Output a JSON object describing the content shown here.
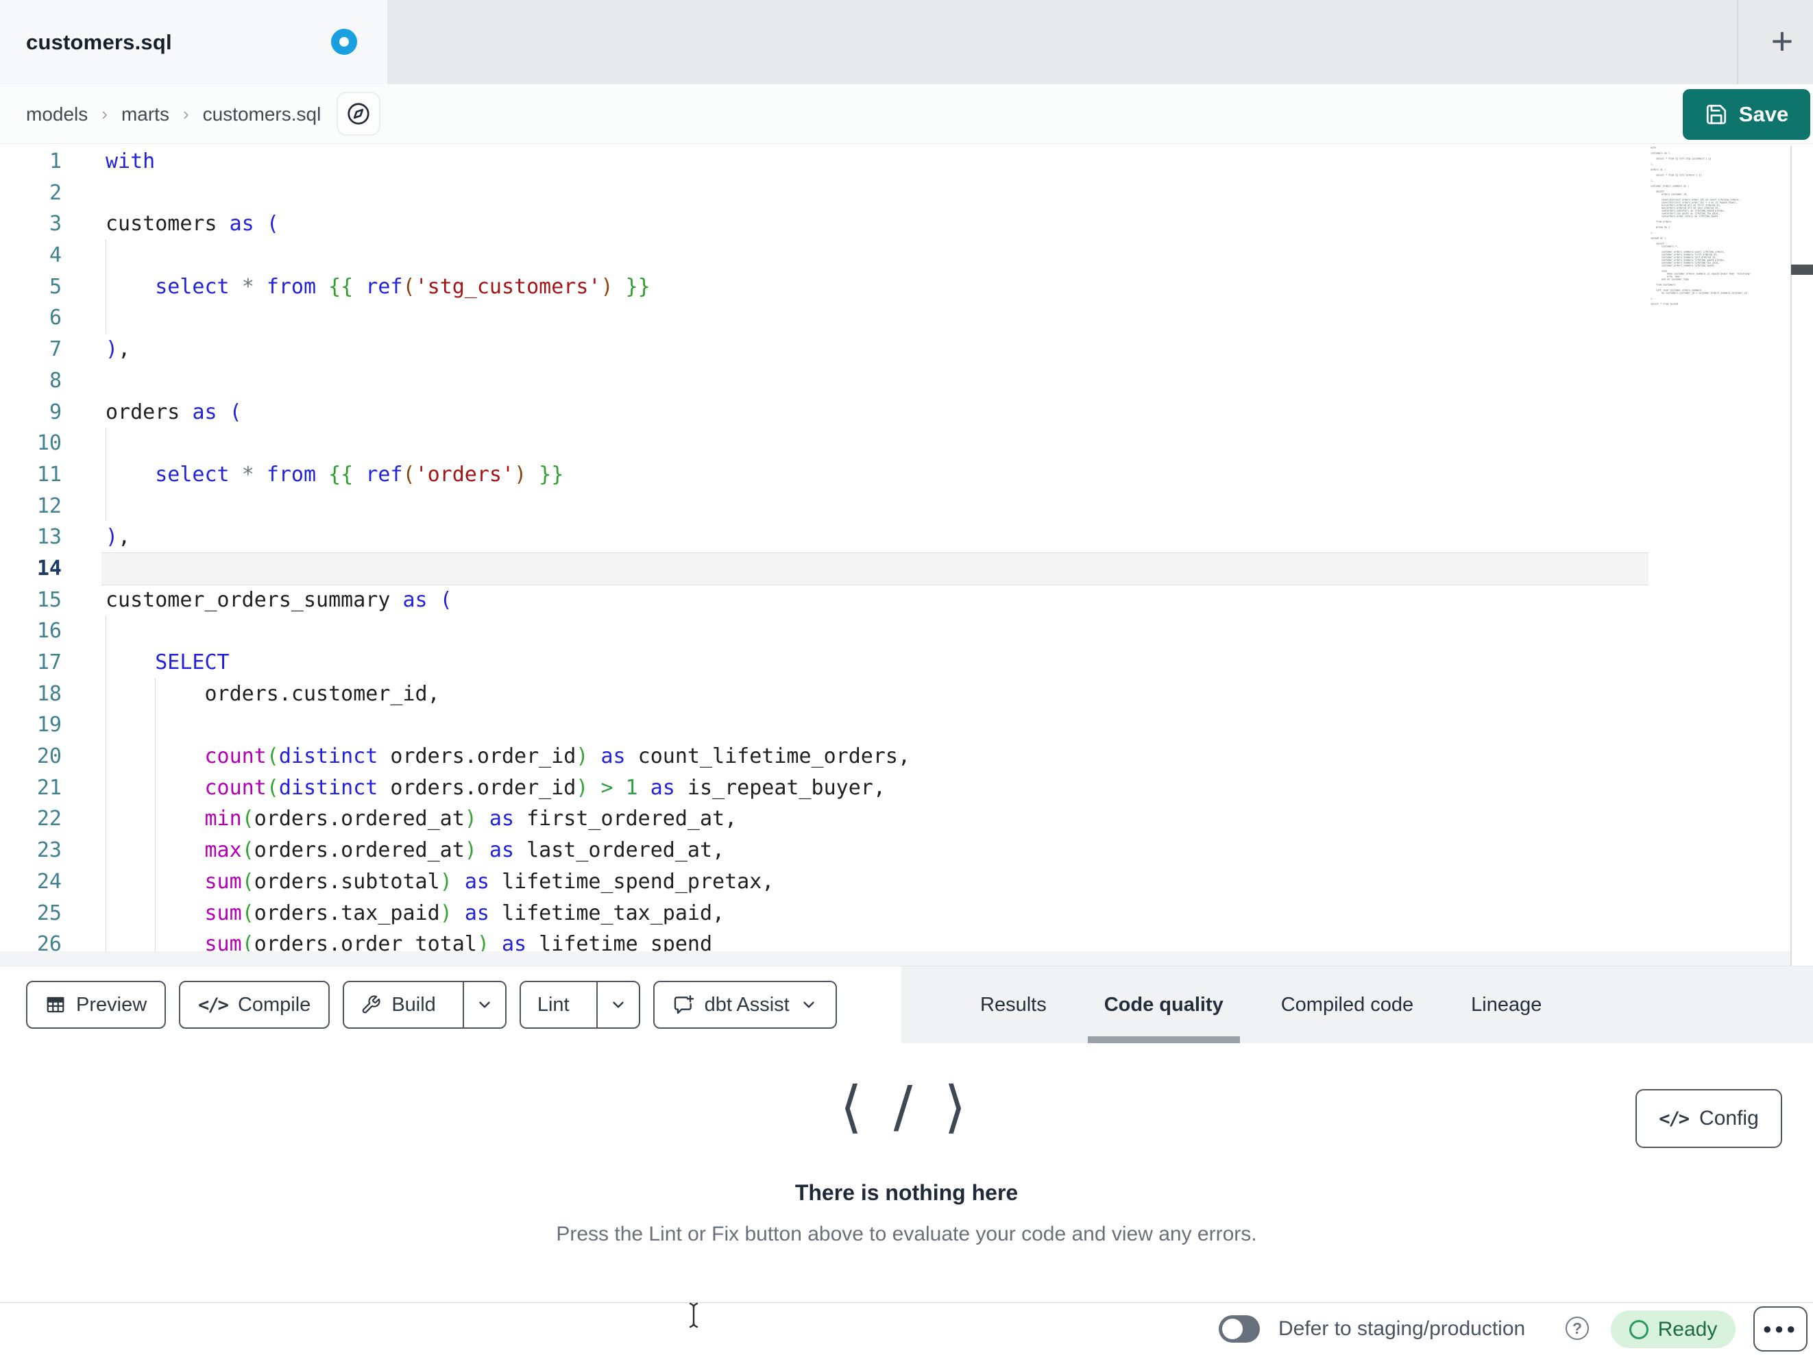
{
  "theme": {
    "tab-bg": "#e8e9ea",
    "surface": "#f7f8f9",
    "save": "#0e756d",
    "dot": "#18a0e0",
    "tok-k": "#2222dd",
    "tok-f": "#b400b4",
    "tok-p": "#36a336",
    "tok-j": "#2e9e2e",
    "tok-jb": "#8b4513",
    "tok-s": "#a31515",
    "tok-n": "#2f9e44",
    "tok-o": "#6e7680",
    "tok-d": "#1f1f1f",
    "ln": "#40808f",
    "ln-active": "#1d3a66",
    "guide": "#d9dadc",
    "active-line-bg": "#f4f4f5",
    "active-line-border": "#dcdee0",
    "btn-border": "#4d5660",
    "tabs-strip": "#f1f2f3",
    "underline": "#9aa0a8",
    "ready-bg": "#d8f2de",
    "ready-fg": "#1d6b3f",
    "ready-ring": "#2a9960",
    "toggle": "#67707c"
  },
  "tab_bar": {
    "active_tab": "customers.sql",
    "new_tab_label": "+"
  },
  "breadcrumb": {
    "items": [
      "models",
      "marts",
      "customers.sql"
    ],
    "separator": "›"
  },
  "save_button": {
    "label": "Save"
  },
  "editor": {
    "active_line": 14,
    "lines": [
      {
        "n": 1,
        "t": [
          [
            "k",
            "with"
          ]
        ]
      },
      {
        "n": 2,
        "t": []
      },
      {
        "n": 3,
        "t": [
          [
            "d",
            "customers "
          ],
          [
            "k",
            "as"
          ],
          [
            "d",
            " "
          ],
          [
            "k",
            "("
          ]
        ]
      },
      {
        "n": 4,
        "g": [
          0
        ],
        "t": []
      },
      {
        "n": 5,
        "g": [
          0
        ],
        "t": [
          [
            "d",
            "    "
          ],
          [
            "k",
            "select"
          ],
          [
            "d",
            " "
          ],
          [
            "o",
            "*"
          ],
          [
            "d",
            " "
          ],
          [
            "k",
            "from"
          ],
          [
            "d",
            " "
          ],
          [
            "j",
            "{{ "
          ],
          [
            "k",
            "ref"
          ],
          [
            "jb",
            "("
          ],
          [
            "s",
            "'stg_customers'"
          ],
          [
            "jb",
            ")"
          ],
          [
            "j",
            " }}"
          ]
        ]
      },
      {
        "n": 6,
        "g": [
          0
        ],
        "t": []
      },
      {
        "n": 7,
        "t": [
          [
            "k",
            ")"
          ],
          [
            "d",
            ","
          ]
        ]
      },
      {
        "n": 8,
        "t": []
      },
      {
        "n": 9,
        "t": [
          [
            "d",
            "orders "
          ],
          [
            "k",
            "as"
          ],
          [
            "d",
            " "
          ],
          [
            "k",
            "("
          ]
        ]
      },
      {
        "n": 10,
        "g": [
          0
        ],
        "t": []
      },
      {
        "n": 11,
        "g": [
          0
        ],
        "t": [
          [
            "d",
            "    "
          ],
          [
            "k",
            "select"
          ],
          [
            "d",
            " "
          ],
          [
            "o",
            "*"
          ],
          [
            "d",
            " "
          ],
          [
            "k",
            "from"
          ],
          [
            "d",
            " "
          ],
          [
            "j",
            "{{ "
          ],
          [
            "k",
            "ref"
          ],
          [
            "jb",
            "("
          ],
          [
            "s",
            "'orders'"
          ],
          [
            "jb",
            ")"
          ],
          [
            "j",
            " }}"
          ]
        ]
      },
      {
        "n": 12,
        "g": [
          0
        ],
        "t": []
      },
      {
        "n": 13,
        "t": [
          [
            "k",
            ")"
          ],
          [
            "d",
            ","
          ]
        ]
      },
      {
        "n": 14,
        "t": []
      },
      {
        "n": 15,
        "t": [
          [
            "d",
            "customer_orders_summary "
          ],
          [
            "k",
            "as"
          ],
          [
            "d",
            " "
          ],
          [
            "k",
            "("
          ]
        ]
      },
      {
        "n": 16,
        "g": [
          0
        ],
        "t": []
      },
      {
        "n": 17,
        "g": [
          0
        ],
        "t": [
          [
            "d",
            "    "
          ],
          [
            "k",
            "SELECT"
          ]
        ]
      },
      {
        "n": 18,
        "g": [
          0,
          4
        ],
        "t": [
          [
            "d",
            "        orders.customer_id,"
          ]
        ]
      },
      {
        "n": 19,
        "g": [
          0,
          4
        ],
        "t": []
      },
      {
        "n": 20,
        "g": [
          0,
          4
        ],
        "t": [
          [
            "d",
            "        "
          ],
          [
            "f",
            "count"
          ],
          [
            "p",
            "("
          ],
          [
            "k",
            "distinct"
          ],
          [
            "d",
            " orders.order_id"
          ],
          [
            "p",
            ")"
          ],
          [
            "d",
            " "
          ],
          [
            "k",
            "as"
          ],
          [
            "d",
            " count_lifetime_orders,"
          ]
        ]
      },
      {
        "n": 21,
        "g": [
          0,
          4
        ],
        "t": [
          [
            "d",
            "        "
          ],
          [
            "f",
            "count"
          ],
          [
            "p",
            "("
          ],
          [
            "k",
            "distinct"
          ],
          [
            "d",
            " orders.order_id"
          ],
          [
            "p",
            ")"
          ],
          [
            "d",
            " "
          ],
          [
            "n",
            ">"
          ],
          [
            "d",
            " "
          ],
          [
            "n",
            "1"
          ],
          [
            "d",
            " "
          ],
          [
            "k",
            "as"
          ],
          [
            "d",
            " is_repeat_buyer,"
          ]
        ]
      },
      {
        "n": 22,
        "g": [
          0,
          4
        ],
        "t": [
          [
            "d",
            "        "
          ],
          [
            "f",
            "min"
          ],
          [
            "p",
            "("
          ],
          [
            "d",
            "orders.ordered_at"
          ],
          [
            "p",
            ")"
          ],
          [
            "d",
            " "
          ],
          [
            "k",
            "as"
          ],
          [
            "d",
            " first_ordered_at,"
          ]
        ]
      },
      {
        "n": 23,
        "g": [
          0,
          4
        ],
        "t": [
          [
            "d",
            "        "
          ],
          [
            "f",
            "max"
          ],
          [
            "p",
            "("
          ],
          [
            "d",
            "orders.ordered_at"
          ],
          [
            "p",
            ")"
          ],
          [
            "d",
            " "
          ],
          [
            "k",
            "as"
          ],
          [
            "d",
            " last_ordered_at,"
          ]
        ]
      },
      {
        "n": 24,
        "g": [
          0,
          4
        ],
        "t": [
          [
            "d",
            "        "
          ],
          [
            "f",
            "sum"
          ],
          [
            "p",
            "("
          ],
          [
            "d",
            "orders.subtotal"
          ],
          [
            "p",
            ")"
          ],
          [
            "d",
            " "
          ],
          [
            "k",
            "as"
          ],
          [
            "d",
            " lifetime_spend_pretax,"
          ]
        ]
      },
      {
        "n": 25,
        "g": [
          0,
          4
        ],
        "t": [
          [
            "d",
            "        "
          ],
          [
            "f",
            "sum"
          ],
          [
            "p",
            "("
          ],
          [
            "d",
            "orders.tax_paid"
          ],
          [
            "p",
            ")"
          ],
          [
            "d",
            " "
          ],
          [
            "k",
            "as"
          ],
          [
            "d",
            " lifetime_tax_paid,"
          ]
        ]
      },
      {
        "n": 26,
        "g": [
          0,
          4
        ],
        "t": [
          [
            "d",
            "        "
          ],
          [
            "f",
            "sum"
          ],
          [
            "p",
            "("
          ],
          [
            "d",
            "orders.order_total"
          ],
          [
            "p",
            ")"
          ],
          [
            "d",
            " "
          ],
          [
            "k",
            "as"
          ],
          [
            "d",
            " lifetime_spend"
          ]
        ]
      }
    ]
  },
  "minimap": {
    "lines": [
      "with",
      "",
      "customers as (",
      "",
      "    select * from {{ ref('stg_customers') }}",
      "",
      "),",
      "",
      "orders as (",
      "",
      "    select * from {{ ref('orders') }}",
      "",
      "),",
      "",
      "customer_orders_summary as (",
      "",
      "    SELECT",
      "        orders.customer_id,",
      "",
      "        count(distinct orders.order_id) as count_lifetime_orders,",
      "        count(distinct orders.order_id) > 1 as is_repeat_buyer,",
      "        min(orders.ordered_at) as first_ordered_at,",
      "        max(orders.ordered_at) as last_ordered_at,",
      "        sum(orders.subtotal) as lifetime_spend_pretax,",
      "        sum(orders.tax_paid) as lifetime_tax_paid,",
      "        sum(orders.order_total) as lifetime_spend",
      "",
      "    from orders",
      "",
      "    group by 1",
      "",
      "),",
      "",
      "joined as (",
      "",
      "    select",
      "        customers.*,",
      "",
      "        customer_orders_summary.count_lifetime_orders,",
      "        customer_orders_summary.first_ordered_at,",
      "        customer_orders_summary.last_ordered_at,",
      "        customer_orders_summary.lifetime_spend_pretax,",
      "        customer_orders_summary.lifetime_tax_paid,",
      "        customer_orders_summary.lifetime_spend,",
      "",
      "        case",
      "            when customer_orders_summary.is_repeat_buyer then 'returning'",
      "            else 'new'",
      "        end as customer_type",
      "",
      "    from customers",
      "",
      "    left join customer_orders_summary",
      "        on customers.customer_id = customer_orders_summary.customer_id",
      "",
      "),",
      "",
      "select * from joined"
    ]
  },
  "toolbar": {
    "preview": "Preview",
    "compile": "Compile",
    "build": "Build",
    "lint": "Lint",
    "assist": "dbt Assist",
    "compile_glyph": "</>"
  },
  "result_tabs": {
    "items": [
      "Results",
      "Code quality",
      "Compiled code",
      "Lineage"
    ],
    "active": "Code quality"
  },
  "empty_state": {
    "icon_glyph": "⟨ / ⟩",
    "title": "There is nothing here",
    "subtitle": "Press the Lint or Fix button above to evaluate your code and view any errors."
  },
  "config_button": {
    "label": "Config",
    "icon_glyph": "</>"
  },
  "status_bar": {
    "defer_label": "Defer to staging/production",
    "help_glyph": "?",
    "ready_label": "Ready",
    "toggle_on": false,
    "more_glyph": "●●●"
  }
}
